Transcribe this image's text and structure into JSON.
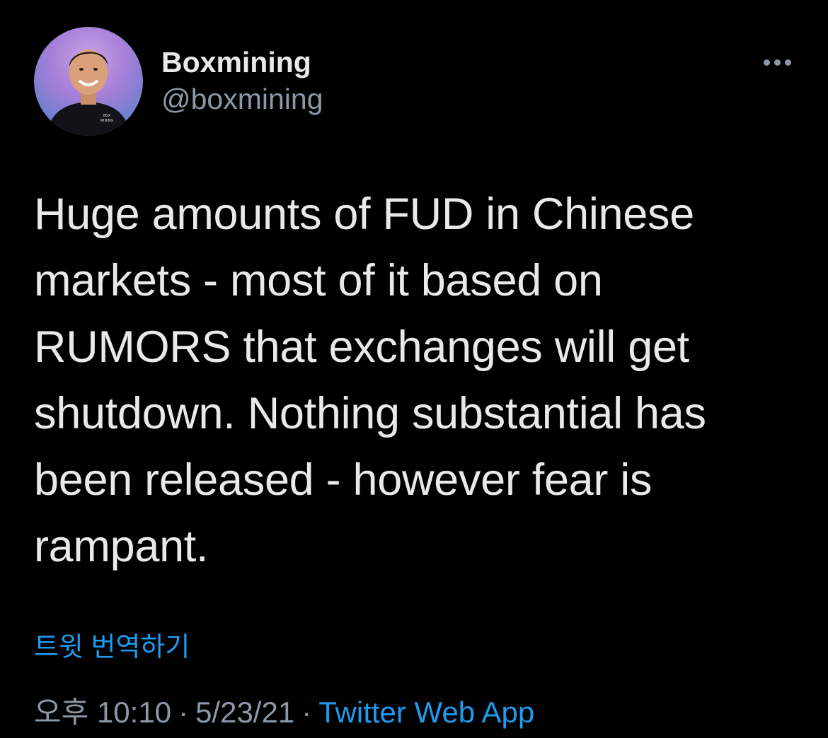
{
  "author": {
    "display_name": "Boxmining",
    "handle": "@boxmining",
    "avatar_icon": "avatar-photo",
    "shirt_text": "BOX MINING"
  },
  "tweet": {
    "text": "Huge amounts of FUD in Chinese markets - most of it based on RUMORS that exchanges will get shutdown. Nothing substantial has been released - however fear is rampant.",
    "translate_label": "트윗 번역하기"
  },
  "meta": {
    "time": "오후 10:10",
    "separator": "·",
    "date": "5/23/21",
    "source": "Twitter Web App"
  },
  "colors": {
    "background": "#000000",
    "text": "#e7e9ea",
    "secondary": "#8b98a5",
    "accent": "#1d9bf0"
  },
  "icons": {
    "more": "more-horizontal-icon"
  }
}
